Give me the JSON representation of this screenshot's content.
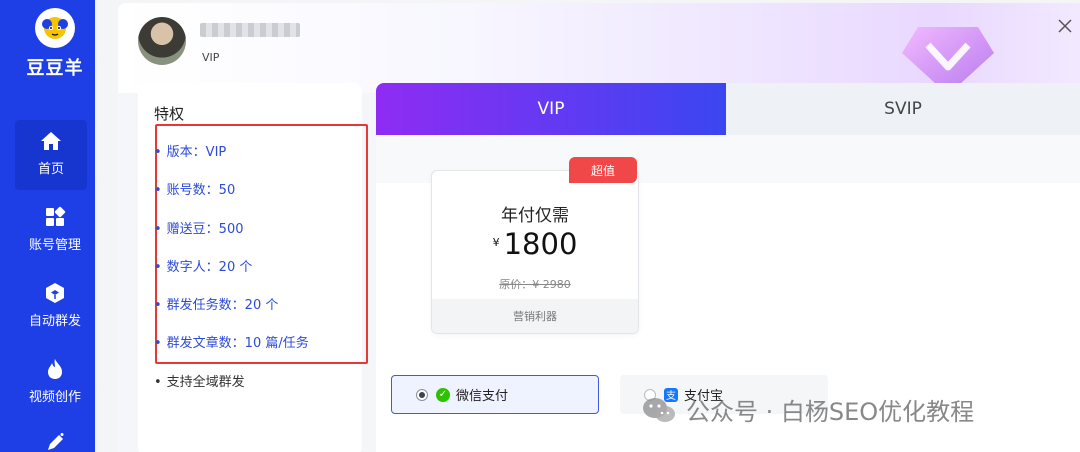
{
  "app": {
    "name": "豆豆羊"
  },
  "sidebar": {
    "items": [
      {
        "label": "首页",
        "icon": "home-icon",
        "active": true
      },
      {
        "label": "账号管理",
        "icon": "grid-icon",
        "active": false
      },
      {
        "label": "自动群发",
        "icon": "cube-icon",
        "active": false
      },
      {
        "label": "视频创作",
        "icon": "flame-icon",
        "active": false
      },
      {
        "label": "",
        "icon": "pen-icon",
        "active": false
      }
    ]
  },
  "user": {
    "tag": "VIP"
  },
  "privileges": {
    "title": "特权",
    "items": [
      "版本：VIP",
      "账号数：50",
      "赠送豆：500",
      "数字人：20 个",
      "群发任务数：20 个",
      "群发文章数：10 篇/任务"
    ],
    "extra": "支持全域群发"
  },
  "tabs": [
    {
      "label": "VIP",
      "selected": true
    },
    {
      "label": "SVIP",
      "selected": false
    }
  ],
  "plan": {
    "badge": "超值",
    "title": "年付仅需",
    "currency": "¥",
    "price": "1800",
    "original": "原价：¥ 2980",
    "footer": "营销利器"
  },
  "payment": {
    "wechat": "微信支付",
    "alipay": "支付宝",
    "selected": "wechat"
  },
  "watermark": {
    "text": "公众号 · 白杨SEO优化教程"
  },
  "colors": {
    "sidebar": "#1f3fe6",
    "vip_tab_start": "#8f2cf3",
    "vip_tab_end": "#3a46f1",
    "highlight_box": "#e53935",
    "privilege_text": "#2d4bd6",
    "badge": "#f04848",
    "wechat_green": "#2dc100",
    "alipay_blue": "#1677ff"
  }
}
